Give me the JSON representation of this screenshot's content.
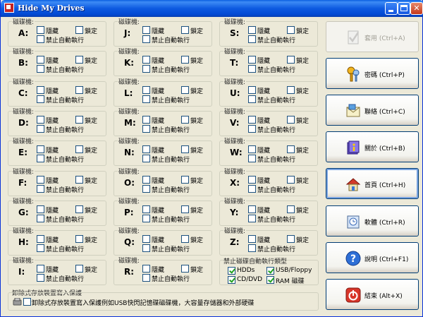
{
  "window": {
    "title": "Hide My Drives"
  },
  "drive_group_title": "磁碟機:",
  "options": {
    "hide": "隱藏",
    "lock": "鎖定",
    "noautorun": "禁止自動執行"
  },
  "drives": [
    "A:",
    "B:",
    "C:",
    "D:",
    "E:",
    "F:",
    "G:",
    "H:",
    "I:",
    "J:",
    "K:",
    "L:",
    "M:",
    "N:",
    "O:",
    "P:",
    "Q:",
    "R:",
    "S:",
    "T:",
    "U:",
    "V:",
    "W:",
    "X:",
    "Y:",
    "Z:"
  ],
  "autorun_types": {
    "title": "禁止磁碟自動執行類型",
    "items": [
      {
        "label": "HDDs",
        "checked": true
      },
      {
        "label": "USB/Floppy",
        "checked": true
      },
      {
        "label": "CD/DVD",
        "checked": true
      },
      {
        "label": "RAM 磁碟",
        "checked": true
      }
    ]
  },
  "write_protect": {
    "title": "卸除式存放裝置寫入保護",
    "label": "卸除式存放裝置寫入保護例如USB快閃記憶碟磁碟機，大容量存儲器和外部硬碟",
    "checked": false
  },
  "buttons": [
    {
      "label": "套用 (Ctrl+A)",
      "icon": "checklist-icon",
      "disabled": true
    },
    {
      "label": "密碼 (Ctrl+P)",
      "icon": "keys-icon"
    },
    {
      "label": "聯絡 (Ctrl+C)",
      "icon": "envelope-icon"
    },
    {
      "label": "關於 (Ctrl+B)",
      "icon": "info-book-icon"
    },
    {
      "label": "首頁 (Ctrl+H)",
      "icon": "home-icon",
      "focused": true
    },
    {
      "label": "軟體 (Ctrl+R)",
      "icon": "software-box-icon"
    },
    {
      "label": "說明 (Ctrl+F1)",
      "icon": "help-icon"
    },
    {
      "label": "結束 (Alt+X)",
      "icon": "exit-icon"
    }
  ]
}
